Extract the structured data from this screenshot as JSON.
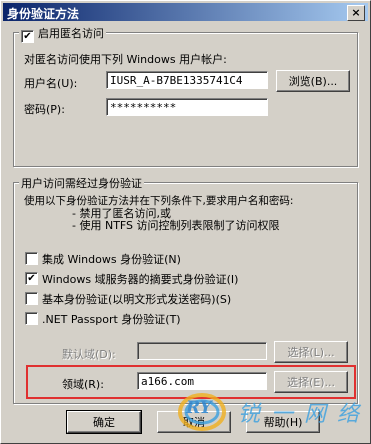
{
  "window": {
    "title": "身份验证方法",
    "close_label": "×"
  },
  "anon_group": {
    "legend": "启用匿名访问",
    "checked": true,
    "description": "对匿名访问使用下列 Windows 用户帐户:",
    "username_label": "用户名(U):",
    "username_value": "IUSR_A-B7BE1335741C4",
    "browse_label": "浏览(B)...",
    "password_label": "密码(P):",
    "password_value": "**********"
  },
  "auth_group": {
    "legend": "用户访问需经过身份验证",
    "description_line1": "使用以下身份验证方法并在下列条件下,要求用户名和密码:",
    "bullet1": "- 禁用了匿名访问,或",
    "bullet2": "- 使用 NTFS 访问控制列表限制了访问权限",
    "options": [
      {
        "label": "集成 Windows 身份验证(N)",
        "checked": false
      },
      {
        "label": "Windows 域服务器的摘要式身份验证(I)",
        "checked": true
      },
      {
        "label": "基本身份验证(以明文形式发送密码)(S)",
        "checked": false
      },
      {
        "label": ".NET Passport 身份验证(T)",
        "checked": false
      }
    ],
    "default_domain_label": "默认域(D):",
    "default_domain_value": "",
    "select1_label": "选择(L)...",
    "realm_label": "领域(R):",
    "realm_value": "a166.com",
    "select2_label": "选择(E)..."
  },
  "footer": {
    "ok": "确定",
    "cancel": "取消",
    "help": "帮助(H)"
  },
  "watermark": {
    "logo": "RY",
    "text": "锐 一 网 络"
  },
  "colors": {
    "highlight": "#e03030",
    "title_start": "#0a246a",
    "title_end": "#a6caf0"
  }
}
